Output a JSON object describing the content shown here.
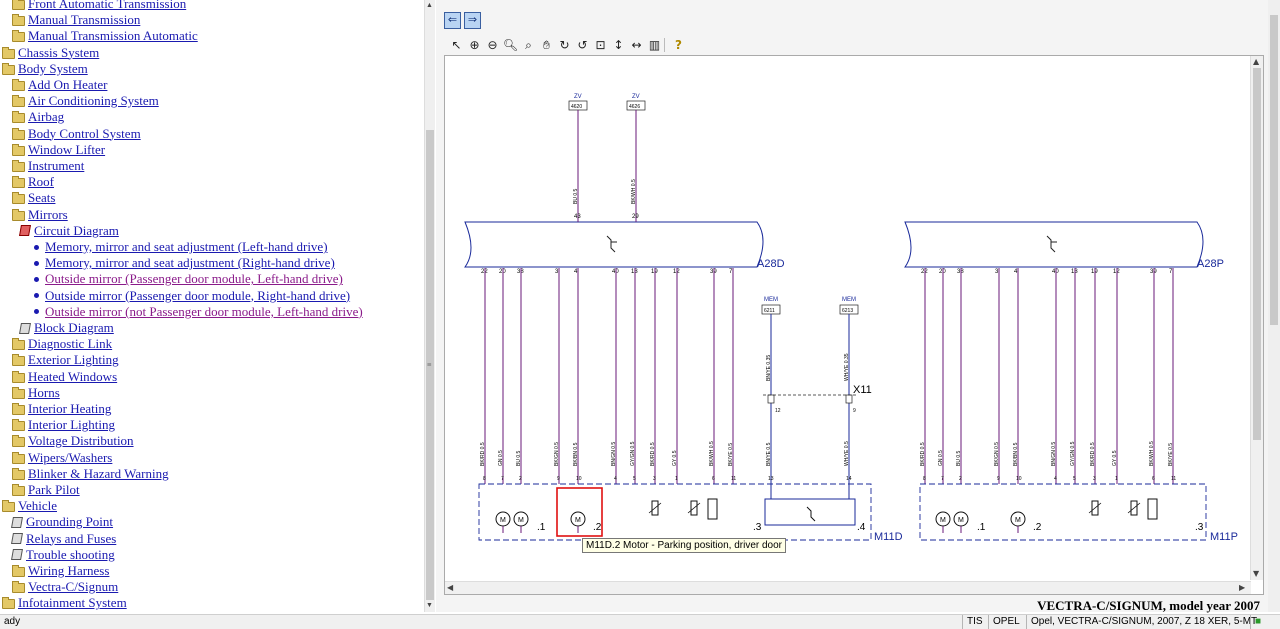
{
  "tree": {
    "items": [
      {
        "label": "Front Automatic Transmission",
        "indent": 1,
        "icon": "folder-icon",
        "visited": false,
        "partial": true
      },
      {
        "label": "Manual Transmission",
        "indent": 1,
        "icon": "folder-icon",
        "visited": false
      },
      {
        "label": "Manual Transmission Automatic",
        "indent": 1,
        "icon": "folder-icon",
        "visited": false
      },
      {
        "label": "Chassis System",
        "indent": 0,
        "icon": "folder-icon",
        "visited": false
      },
      {
        "label": "Body System",
        "indent": 0,
        "icon": "folder-open-icon",
        "visited": false
      },
      {
        "label": "Add On Heater",
        "indent": 1,
        "icon": "folder-icon",
        "visited": false
      },
      {
        "label": "Air Conditioning System",
        "indent": 1,
        "icon": "folder-icon",
        "visited": false
      },
      {
        "label": "Airbag",
        "indent": 1,
        "icon": "folder-icon",
        "visited": false
      },
      {
        "label": "Body Control System",
        "indent": 1,
        "icon": "folder-icon",
        "visited": false
      },
      {
        "label": "Window Lifter",
        "indent": 1,
        "icon": "folder-icon",
        "visited": false
      },
      {
        "label": "Instrument",
        "indent": 1,
        "icon": "folder-icon",
        "visited": false
      },
      {
        "label": "Roof",
        "indent": 1,
        "icon": "folder-icon",
        "visited": false
      },
      {
        "label": "Seats",
        "indent": 1,
        "icon": "folder-icon",
        "visited": false
      },
      {
        "label": "Mirrors",
        "indent": 1,
        "icon": "folder-open-icon",
        "visited": false
      },
      {
        "label": "Circuit Diagram",
        "indent": 2,
        "icon": "circuit-doc-icon",
        "visited": false
      },
      {
        "label": "Memory, mirror and seat adjustment (Left-hand drive)",
        "indent": 3,
        "icon": "bullet-icon",
        "visited": false
      },
      {
        "label": "Memory, mirror and seat adjustment (Right-hand drive)",
        "indent": 3,
        "icon": "bullet-icon",
        "visited": false
      },
      {
        "label": "Outside mirror (Passenger door module, Left-hand drive)",
        "indent": 3,
        "icon": "bullet-icon",
        "visited": true
      },
      {
        "label": "Outside mirror (Passenger door module, Right-hand drive)",
        "indent": 3,
        "icon": "bullet-icon",
        "visited": false
      },
      {
        "label": "Outside mirror (not Passenger door module, Left-hand drive)",
        "indent": 3,
        "icon": "bullet-icon",
        "visited": true
      },
      {
        "label": "Block Diagram",
        "indent": 2,
        "icon": "block-doc-icon",
        "visited": false
      },
      {
        "label": "Diagnostic Link",
        "indent": 1,
        "icon": "folder-icon",
        "visited": false
      },
      {
        "label": "Exterior Lighting",
        "indent": 1,
        "icon": "folder-icon",
        "visited": false
      },
      {
        "label": "Heated Windows",
        "indent": 1,
        "icon": "folder-icon",
        "visited": false
      },
      {
        "label": "Horns",
        "indent": 1,
        "icon": "folder-icon",
        "visited": false
      },
      {
        "label": "Interior Heating",
        "indent": 1,
        "icon": "folder-icon",
        "visited": false
      },
      {
        "label": "Interior Lighting",
        "indent": 1,
        "icon": "folder-icon",
        "visited": false
      },
      {
        "label": "Voltage Distribution",
        "indent": 1,
        "icon": "folder-icon",
        "visited": false
      },
      {
        "label": "Wipers/Washers",
        "indent": 1,
        "icon": "folder-icon",
        "visited": false
      },
      {
        "label": "Blinker & Hazard Warning",
        "indent": 1,
        "icon": "folder-icon",
        "visited": false
      },
      {
        "label": "Park Pilot",
        "indent": 1,
        "icon": "folder-icon",
        "visited": false
      },
      {
        "label": "Vehicle",
        "indent": 0,
        "icon": "folder-open-icon",
        "visited": false
      },
      {
        "label": "Grounding Point",
        "indent": 1,
        "icon": "doc-icon",
        "visited": false
      },
      {
        "label": "Relays and Fuses",
        "indent": 1,
        "icon": "doc-icon",
        "visited": false
      },
      {
        "label": "Trouble shooting",
        "indent": 1,
        "icon": "doc-icon",
        "visited": false
      },
      {
        "label": "Wiring Harness",
        "indent": 1,
        "icon": "folder-icon",
        "visited": false
      },
      {
        "label": "Vectra-C/Signum",
        "indent": 1,
        "icon": "folder-icon",
        "visited": false
      },
      {
        "label": "Infotainment System",
        "indent": 0,
        "icon": "folder-icon",
        "visited": false
      }
    ]
  },
  "navbar": {
    "back_icon": "back-arrow-icon",
    "forward_icon": "forward-arrow-icon"
  },
  "toolbar": {
    "tools": [
      "select-pointer-icon",
      "zoom-in-icon",
      "zoom-out-icon",
      "zoom-icon",
      "zoom-area-icon",
      "pan-hand-icon",
      "rotate-right-icon",
      "rotate-left-icon",
      "fit-page-icon",
      "fit-height-icon",
      "fit-width-icon",
      "measure-icon",
      "help-icon"
    ]
  },
  "diagram": {
    "left_connector_label": "A28D",
    "right_connector_label": "A28P",
    "left_module_label": "M11D",
    "right_module_label": "M11P",
    "left_pins": [
      "22",
      "20",
      "38",
      "3",
      "4",
      "40",
      "13",
      "19",
      "12",
      "39",
      "7"
    ],
    "right_pins": [
      "22",
      "20",
      "38",
      "3",
      "4",
      "40",
      "13",
      "19",
      "12",
      "39",
      "7"
    ],
    "left_wire_colors": [
      "BK/RD 0.5",
      "GN 0.5",
      "BU 0.5",
      "BK/GN 0.5",
      "BK/BN 0.5",
      "BN/GN 0.5",
      "GY/GN 0.5",
      "BK/RD 0.5",
      "GY 0.5",
      "BK/WH 0.5",
      "BK/YE 0.5"
    ],
    "left_module_pins": [
      "8",
      "7",
      "2",
      "9",
      "10",
      "4",
      "5",
      "3",
      "1",
      "6",
      "11"
    ],
    "top_feed": [
      {
        "label": "ZV",
        "number": "4620",
        "wire": "BU 0.5",
        "pin": "43"
      },
      {
        "label": "ZV",
        "number": "4626",
        "wire": "BK/WH 0.5",
        "pin": "29"
      }
    ],
    "mem_feed": [
      {
        "label": "MEM",
        "number": "6211",
        "wire": "BN/YE 0.35",
        "pin": "12",
        "lower_wire": "BN/YE 0.5",
        "module_pin": "13"
      },
      {
        "label": "MEM",
        "number": "6213",
        "wire": "WH/YE 0.35",
        "pin": "9",
        "lower_wire": "WH/YE 0.5",
        "module_pin": "14"
      }
    ],
    "x_connector": "X11",
    "sub_labels": [
      ".1",
      ".2",
      ".3",
      ".4"
    ],
    "right_sub_labels": [
      ".1",
      ".2",
      ".3"
    ]
  },
  "tooltip": {
    "text": "M11D.2 Motor - Parking position, driver door"
  },
  "vehicle_title": "VECTRA-C/SIGNUM, model year 2007",
  "status": {
    "left": "ady",
    "tis": "TIS",
    "brand": "OPEL",
    "vehicle_info": "Opel, VECTRA-C/SIGNUM, 2007, Z 18 XER, 5-MT"
  },
  "colors": {
    "link": "#1a1ab0",
    "visited_link": "#8a1a8a",
    "wire": "#6a1a7a",
    "diagram_blue": "#1a2a9a",
    "highlight": "#e01010"
  }
}
